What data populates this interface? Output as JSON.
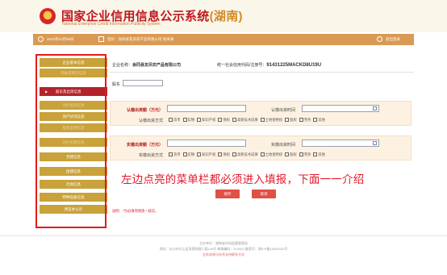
{
  "header": {
    "title": "国家企业信用信息公示系统",
    "region": "(湖南)",
    "subtitle": "National Enterprise Credit Information Publicity System"
  },
  "topbar": {
    "date": "2024年01月08日",
    "account": "您好：会同县友凤农产品有限公司  尚未填",
    "logout": "退出登录"
  },
  "sidebar": {
    "items": [
      {
        "label": "企业基本信息",
        "state": "normal"
      },
      {
        "label": "网站或网店信息",
        "state": "dim"
      },
      {
        "label": "股东及出资信息",
        "state": "active"
      },
      {
        "label": "对外投资信息",
        "state": "dim"
      },
      {
        "label": "资产状况信息",
        "state": "normal"
      },
      {
        "label": "股权变更信息",
        "state": "dim"
      },
      {
        "label": "对外担保信息",
        "state": "dim"
      },
      {
        "label": "党建信息",
        "state": "normal"
      },
      {
        "label": "团建信息",
        "state": "normal"
      },
      {
        "label": "社保信息",
        "state": "normal"
      },
      {
        "label": "特种设备信息",
        "state": "normal"
      },
      {
        "label": "预览并公示",
        "state": "normal"
      }
    ]
  },
  "company": {
    "name_label": "企业名称：",
    "name_value": "会同县友凤农产品有限公司",
    "code_label": "统一社会信用代码/注册号：",
    "code_value": "91431225MACKD8U19U"
  },
  "form": {
    "shareholder_label": "股东",
    "shareholder_value": "",
    "subscribed": {
      "amount_label": "认缴出资额（万元）",
      "date_label": "认缴出资时间",
      "method_label": "认缴出资方式"
    },
    "paid": {
      "amount_label": "实缴出资额（万元）",
      "date_label": "实缴出资时间",
      "method_label": "实缴出资方式"
    },
    "methods": [
      "货币",
      "实物",
      "知识产权",
      "债权",
      "高新技术成果",
      "土地使用权",
      "股权",
      "劳务",
      "其他"
    ]
  },
  "overlay_text": "左边点亮的菜单栏都必须进入填报，下面一一介绍",
  "buttons": {
    "save": "保存",
    "cancel": "取消"
  },
  "note": "说明：*为必填项请逐一核实。",
  "footer": {
    "line1": "主办单位：湖南省市场监督管理局",
    "line2": "地址：长沙市天心区芙蓉南路二段118号  邮政编码：410004  备案号：湘ICP备16053442号",
    "line3": "业务咨询与技术支持联系方式"
  },
  "colors": {
    "brand_red": "#c0181f",
    "sidebar_gold": "#c9a23b",
    "sidebar_active": "#b3242a",
    "topbar": "#d99a54",
    "annotation_red": "#e31a1a"
  }
}
